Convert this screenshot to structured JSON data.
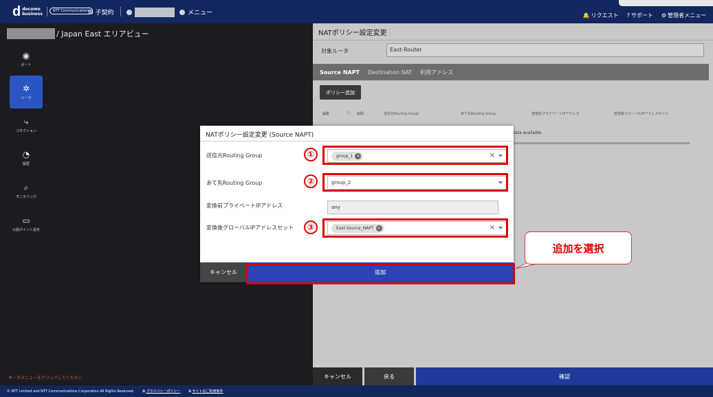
{
  "header": {
    "logo_d": "d",
    "logo_text_1": "docomo",
    "logo_text_2": "business",
    "ntt_label": "NTT Communications",
    "contract_label": "子契約",
    "menu_label": "メニュー",
    "right_links": [
      "リクエスト",
      "サポート",
      "管理者メニュー"
    ],
    "right_icons": [
      "bell-icon",
      "help-icon",
      "gear-icon"
    ]
  },
  "breadcrumb": {
    "suffix": "/ Japan East エリアビュー"
  },
  "sidebar": {
    "items": [
      {
        "label": "ポート",
        "icon": "port-icon",
        "glyph": "◉"
      },
      {
        "label": "ルータ",
        "icon": "router-icon",
        "glyph": "✲"
      },
      {
        "label": "コネクション",
        "icon": "connection-icon",
        "glyph": "⤷"
      },
      {
        "label": "履歴",
        "icon": "history-icon",
        "glyph": "◔"
      },
      {
        "label": "モニタリング",
        "icon": "monitoring-icon",
        "glyph": "⌕"
      },
      {
        "label": "公開ポイント設定",
        "icon": "monitor-icon",
        "glyph": "▭"
      }
    ],
    "active_index": 1
  },
  "panel": {
    "title": "NATポリシー設定変更",
    "target_label": "対象ルータ",
    "target_value": "East-Router",
    "tabs": [
      "Source NAPT",
      "Destination NAT",
      "利用アドレス"
    ],
    "add_policy_label": "ポリシー追加",
    "table_headers": [
      "編集",
      "削除",
      "送信元Routing Group",
      "あて先Routing Group",
      "変換前プライベートIPアドレス",
      "変換後グローバルIPアドレスセット"
    ],
    "no_data": "data available",
    "footer": {
      "cancel": "キャンセル",
      "back": "戻る",
      "confirm": "確認"
    }
  },
  "hint": "オーダメニューをクリックしてください",
  "footer": {
    "copyright": "© NTT Limited and NTT Communications Corporation All Rights Reserved.",
    "privacy": "プライバシーポリシー",
    "terms": "サイトのご利用条件"
  },
  "modal": {
    "title": "NATポリシー設定変更 (Source NAPT)",
    "fields": [
      {
        "label": "送信元Routing Group",
        "chip": "group_1"
      },
      {
        "label": "あて先Routing Group",
        "value": "group_2"
      },
      {
        "label": "変換前プライベートIPアドレス",
        "value": "any"
      },
      {
        "label": "変換後グローバルIPアドレスセット",
        "chip": "East-Source_NAPT"
      }
    ],
    "cancel_label": "キャンセル",
    "add_label": "追加"
  },
  "annotations": {
    "numbers": [
      "①",
      "②",
      "③"
    ],
    "callout": "追加を選択",
    "color": "#e00000"
  }
}
